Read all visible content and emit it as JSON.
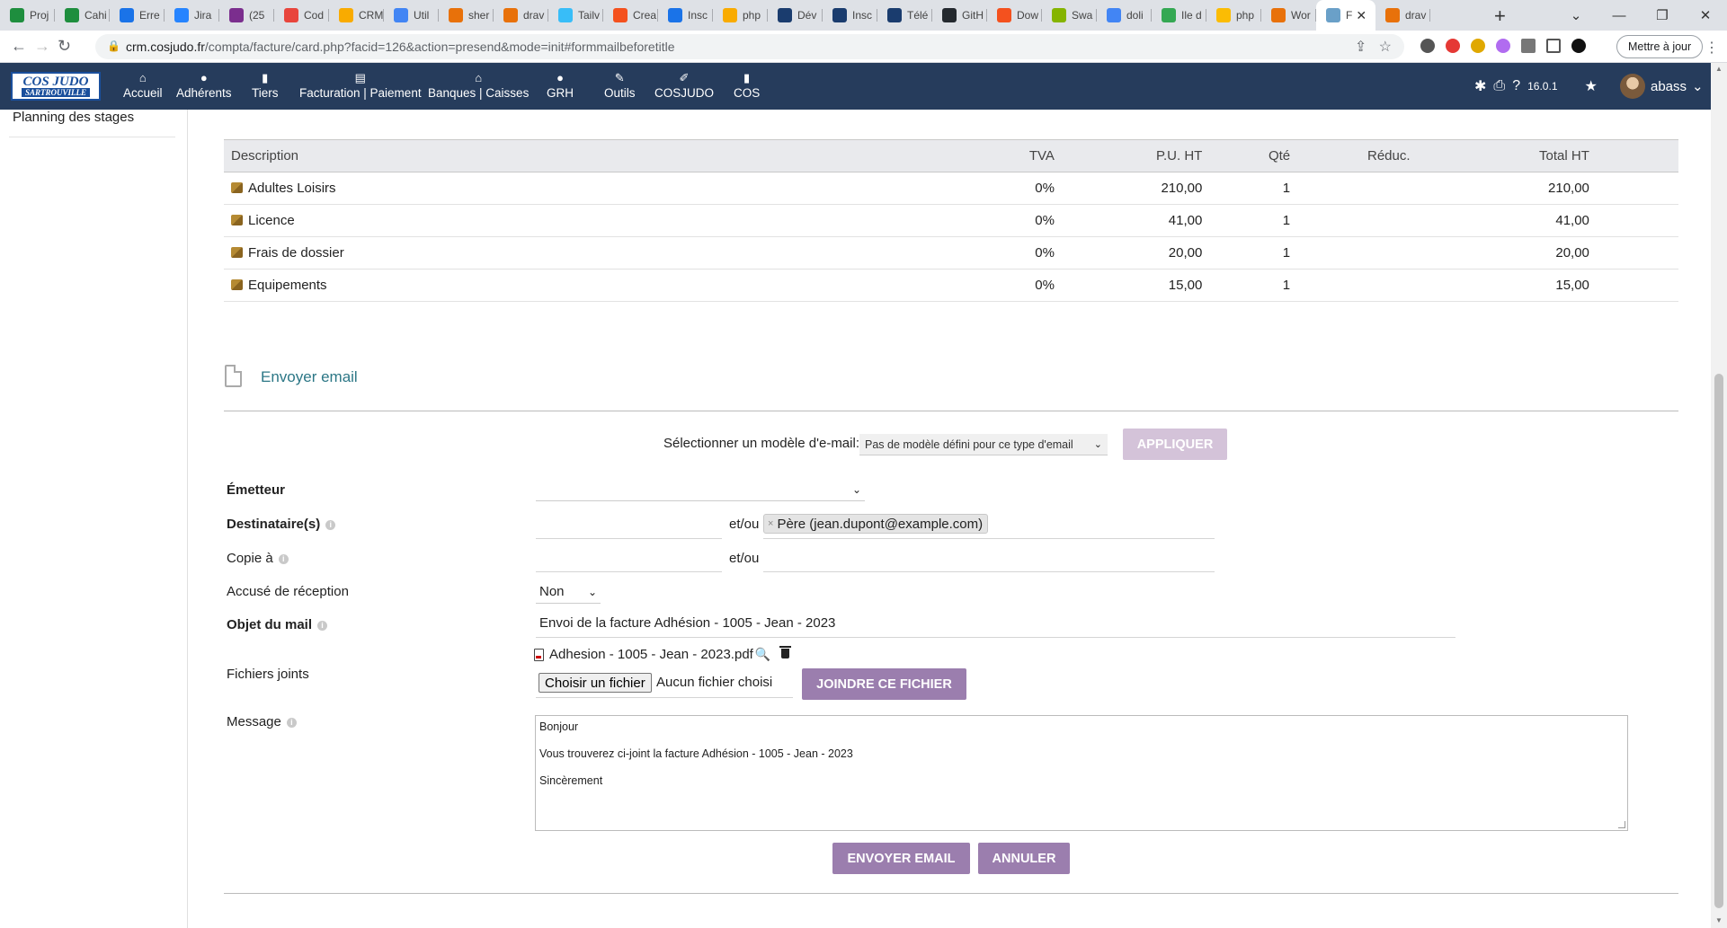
{
  "browser": {
    "tabs": [
      {
        "label": "Proj",
        "color": "#1e8e3e"
      },
      {
        "label": "Cahi",
        "color": "#1e8e3e"
      },
      {
        "label": "Erre",
        "color": "#1a73e8"
      },
      {
        "label": "Jira",
        "color": "#2684ff"
      },
      {
        "label": "(25",
        "color": "#7b2e8e"
      },
      {
        "label": "Cod",
        "color": "#e8453c"
      },
      {
        "label": "CRM",
        "color": "#f9ab00"
      },
      {
        "label": "Util",
        "color": "#4285f4"
      },
      {
        "label": "sher",
        "color": "#e8710a"
      },
      {
        "label": "drav",
        "color": "#e8710a"
      },
      {
        "label": "Tailv",
        "color": "#38bdf8"
      },
      {
        "label": "Crea",
        "color": "#f4511e"
      },
      {
        "label": "Insc",
        "color": "#1a73e8"
      },
      {
        "label": "php",
        "color": "#f9ab00"
      },
      {
        "label": "Dév",
        "color": "#1a3c6e"
      },
      {
        "label": "Insc",
        "color": "#1a3c6e"
      },
      {
        "label": "Télé",
        "color": "#1a3c6e"
      },
      {
        "label": "GitH",
        "color": "#24292f"
      },
      {
        "label": "Dow",
        "color": "#f4511e"
      },
      {
        "label": "Swa",
        "color": "#85b400"
      },
      {
        "label": "doli",
        "color": "#4285f4"
      },
      {
        "label": "Ile d",
        "color": "#34a853"
      },
      {
        "label": "php",
        "color": "#fbbc04"
      },
      {
        "label": "Wor",
        "color": "#e8710a"
      },
      {
        "label": "F",
        "color": "#6aa0c8",
        "active": true
      },
      {
        "label": "drav",
        "color": "#e8710a"
      }
    ],
    "new_tab": "+",
    "url_host": "crm.cosjudo.fr",
    "url_path": "/compta/facture/card.php?facid=126&action=presend&mode=init#formmailbeforetitle",
    "update_button": "Mettre à jour"
  },
  "app": {
    "logo_top": "COS JUDO",
    "logo_bottom": "SARTROUVILLE",
    "menu": [
      {
        "label": "Accueil",
        "icon": "home-icon"
      },
      {
        "label": "Adhérents",
        "icon": "user-icon"
      },
      {
        "label": "Tiers",
        "icon": "building-icon"
      },
      {
        "label": "Facturation | Paiement",
        "icon": "money-icon"
      },
      {
        "label": "Banques | Caisses",
        "icon": "bank-icon"
      },
      {
        "label": "GRH",
        "icon": "person-icon"
      },
      {
        "label": "Outils",
        "icon": "wrench-icon"
      },
      {
        "label": "COSJUDO",
        "icon": "edit-icon"
      },
      {
        "label": "COS",
        "icon": "doc-icon"
      }
    ],
    "version": "16.0.1",
    "user": "abass"
  },
  "sidebar": {
    "items": [
      "Planning des stages"
    ]
  },
  "lines_table": {
    "headers": [
      "Description",
      "TVA",
      "P.U. HT",
      "Qté",
      "Réduc.",
      "Total HT"
    ],
    "rows": [
      {
        "desc": "Adultes Loisirs",
        "tva": "0%",
        "pu": "210,00",
        "qty": "1",
        "reduc": "",
        "total": "210,00"
      },
      {
        "desc": "Licence",
        "tva": "0%",
        "pu": "41,00",
        "qty": "1",
        "reduc": "",
        "total": "41,00"
      },
      {
        "desc": "Frais de dossier",
        "tva": "0%",
        "pu": "20,00",
        "qty": "1",
        "reduc": "",
        "total": "20,00"
      },
      {
        "desc": "Equipements",
        "tva": "0%",
        "pu": "15,00",
        "qty": "1",
        "reduc": "",
        "total": "15,00"
      }
    ]
  },
  "email_form": {
    "section_title": "Envoyer email",
    "template_label": "Sélectionner un modèle d'e-mail:",
    "template_value": "Pas de modèle défini pour ce type d'email",
    "apply_button": "APPLIQUER",
    "sender_label": "Émetteur",
    "sender_value": "",
    "recipients_label": "Destinataire(s)",
    "recipients_or": "et/ou",
    "recipient_tag": "Père (jean.dupont@example.com)",
    "recipient_tag_remove": "×",
    "cc_label": "Copie à",
    "cc_or": "et/ou",
    "ack_label": "Accusé de réception",
    "ack_value": "Non",
    "subject_label": "Objet du mail",
    "subject_value": "Envoi de la facture Adhésion - 1005 - Jean - 2023",
    "attachments_label": "Fichiers joints",
    "attachment_file": "Adhesion - 1005 - Jean - 2023.pdf",
    "choose_file_button": "Choisir un fichier",
    "no_file_text": "Aucun fichier choisi",
    "join_file_button": "JOINDRE CE FICHIER",
    "message_label": "Message",
    "message_lines": [
      "Bonjour",
      "Vous trouverez ci-joint la facture Adhésion - 1005 - Jean - 2023",
      "Sincèrement"
    ],
    "send_button": "ENVOYER EMAIL",
    "cancel_button": "ANNULER"
  }
}
